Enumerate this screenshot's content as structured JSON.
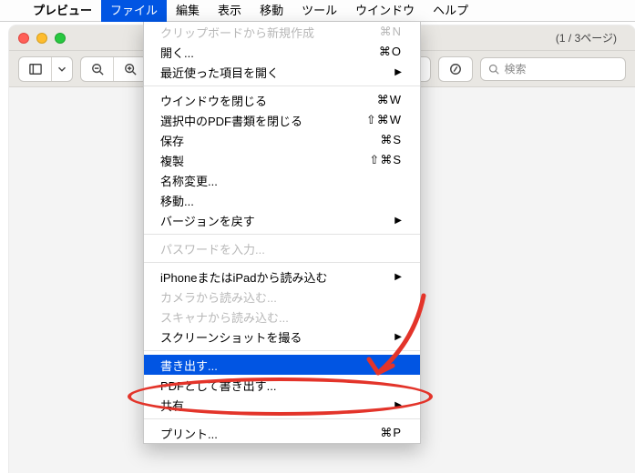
{
  "menubar": {
    "app_name": "プレビュー",
    "items": [
      "ファイル",
      "編集",
      "表示",
      "移動",
      "ツール",
      "ウインドウ",
      "ヘルプ"
    ],
    "active_index": 0
  },
  "window": {
    "page_info": "(1 / 3ページ)",
    "search_placeholder": "検索"
  },
  "dropdown": {
    "sections": [
      [
        {
          "label": "クリップボードから新規作成",
          "shortcut": "⌘N",
          "disabled": true
        },
        {
          "label": "開く...",
          "shortcut": "⌘O"
        },
        {
          "label": "最近使った項目を開く",
          "submenu": true
        }
      ],
      [
        {
          "label": "ウインドウを閉じる",
          "shortcut": "⌘W"
        },
        {
          "label": "選択中のPDF書類を閉じる",
          "shortcut": "⇧⌘W"
        },
        {
          "label": "保存",
          "shortcut": "⌘S"
        },
        {
          "label": "複製",
          "shortcut": "⇧⌘S"
        },
        {
          "label": "名称変更..."
        },
        {
          "label": "移動..."
        },
        {
          "label": "バージョンを戻す",
          "submenu": true
        }
      ],
      [
        {
          "label": "パスワードを入力...",
          "disabled": true
        }
      ],
      [
        {
          "label": "iPhoneまたはiPadから読み込む",
          "submenu": true
        },
        {
          "label": "カメラから読み込む...",
          "disabled": true
        },
        {
          "label": "スキャナから読み込む...",
          "disabled": true
        },
        {
          "label": "スクリーンショットを撮る",
          "submenu": true
        }
      ],
      [
        {
          "label": "書き出す...",
          "highlighted": true
        },
        {
          "label": "PDFとして書き出す..."
        },
        {
          "label": "共有",
          "submenu": true
        }
      ],
      [
        {
          "label": "プリント...",
          "shortcut": "⌘P"
        }
      ]
    ]
  }
}
